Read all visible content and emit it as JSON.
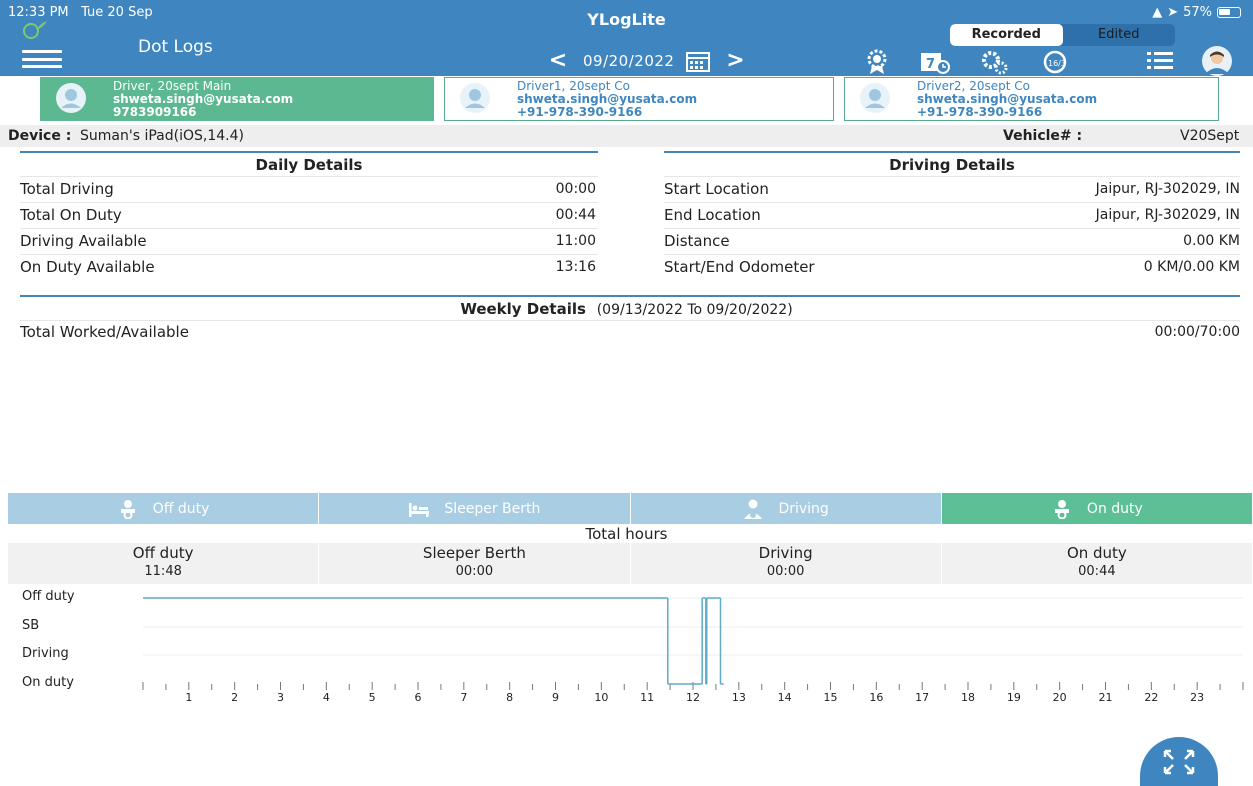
{
  "status_bar": {
    "time": "12:33 PM",
    "date": "Tue 20 Sep",
    "battery": "57%"
  },
  "header": {
    "app_title": "YLogLite",
    "page_title": "Dot Logs",
    "recorded_label": "Recorded",
    "edited_label": "Edited",
    "date": "09/20/2022",
    "prev_arrow": "<",
    "next_arrow": ">"
  },
  "drivers": [
    {
      "name": "Driver, 20sept Main",
      "email": "shweta.singh@yusata.com",
      "phone": "9783909166",
      "active": true
    },
    {
      "name": "Driver1, 20sept Co",
      "email": "shweta.singh@yusata.com",
      "phone": "+91-978-390-9166",
      "active": false
    },
    {
      "name": "Driver2, 20sept Co",
      "email": "shweta.singh@yusata.com",
      "phone": "+91-978-390-9166",
      "active": false
    }
  ],
  "device": {
    "label": "Device :",
    "value": "Suman's iPad(iOS,14.4)",
    "vehicle_label": "Vehicle# :",
    "vehicle_value": "V20Sept"
  },
  "daily_details": {
    "title": "Daily Details",
    "rows": [
      {
        "label": "Total Driving",
        "value": "00:00"
      },
      {
        "label": "Total On Duty",
        "value": "00:44"
      },
      {
        "label": "Driving Available",
        "value": "11:00"
      },
      {
        "label": "On Duty Available",
        "value": "13:16"
      }
    ]
  },
  "driving_details": {
    "title": "Driving Details",
    "rows": [
      {
        "label": "Start Location",
        "value": "Jaipur, RJ-302029, IN"
      },
      {
        "label": "End Location",
        "value": "Jaipur, RJ-302029, IN"
      },
      {
        "label": "Distance",
        "value": "0.00 KM"
      },
      {
        "label": "Start/End Odometer",
        "value": "0 KM/0.00 KM"
      }
    ]
  },
  "weekly_details": {
    "title": "Weekly Details",
    "range": "(09/13/2022 To 09/20/2022)",
    "label": "Total Worked/Available",
    "value": "00:00/70:00"
  },
  "duty_tabs": [
    {
      "label": "Off duty",
      "active": false,
      "icon": "baby-seat-icon"
    },
    {
      "label": "Sleeper Berth",
      "active": false,
      "icon": "bed-icon"
    },
    {
      "label": "Driving",
      "active": false,
      "icon": "driver-icon"
    },
    {
      "label": "On duty",
      "active": true,
      "icon": "baby-seat-icon"
    }
  ],
  "total_hours": {
    "title": "Total hours",
    "cells": [
      {
        "label": "Off duty",
        "value": "11:48"
      },
      {
        "label": "Sleeper Berth",
        "value": "00:00"
      },
      {
        "label": "Driving",
        "value": "00:00"
      },
      {
        "label": "On duty",
        "value": "00:44"
      }
    ]
  },
  "chart_data": {
    "type": "line",
    "y_categories": [
      "Off duty",
      "SB",
      "Driving",
      "On duty"
    ],
    "x_ticks": [
      "1",
      "2",
      "3",
      "4",
      "5",
      "6",
      "7",
      "8",
      "9",
      "10",
      "11",
      "12",
      "13",
      "14",
      "15",
      "16",
      "17",
      "18",
      "19",
      "20",
      "21",
      "22",
      "23"
    ],
    "xlim": [
      0,
      24
    ],
    "segments": [
      {
        "status": "Off duty",
        "start": 0.0,
        "end": 11.45
      },
      {
        "status": "On duty",
        "start": 11.45,
        "end": 12.2
      },
      {
        "status": "Off duty",
        "start": 12.2,
        "end": 12.28
      },
      {
        "status": "On duty",
        "start": 12.28,
        "end": 12.3
      },
      {
        "status": "Off duty",
        "start": 12.3,
        "end": 12.6
      },
      {
        "status": "On duty",
        "start": 12.6,
        "end": 12.67
      }
    ],
    "line_color": "#5fa9c9"
  }
}
